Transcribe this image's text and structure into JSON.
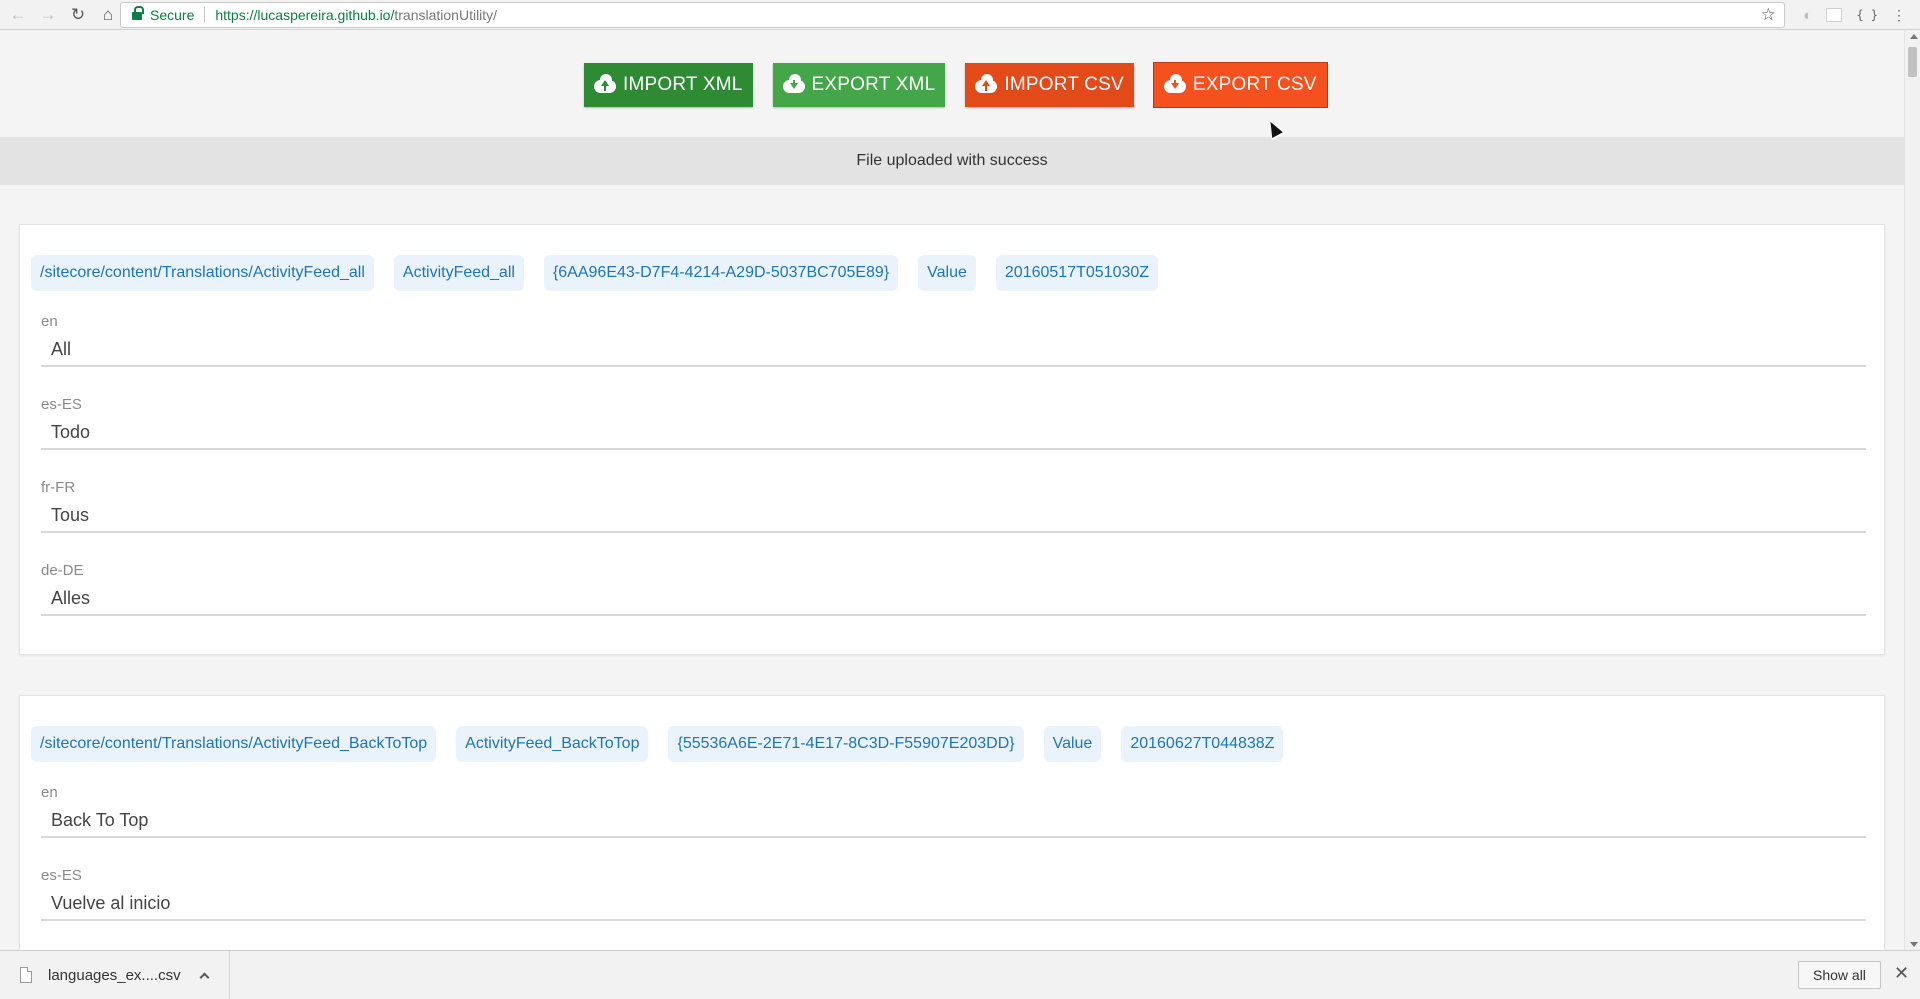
{
  "browser": {
    "secure_label": "Secure",
    "url_host": "https://lucaspereira.github.io/",
    "url_path": "translationUtility/"
  },
  "actions": [
    {
      "label": "IMPORT XML",
      "color": "#2e8b34",
      "direction": "up"
    },
    {
      "label": "EXPORT XML",
      "color": "#43a648",
      "direction": "down"
    },
    {
      "label": "IMPORT CSV",
      "color": "#e34a1a",
      "direction": "up"
    },
    {
      "label": "EXPORT CSV",
      "color": "#f4511e",
      "direction": "down"
    }
  ],
  "status_message": "File uploaded with success",
  "entries": [
    {
      "path": "/sitecore/content/Translations/ActivityFeed_all",
      "name": "ActivityFeed_all",
      "id": "{6AA96E43-D7F4-4214-A29D-5037BC705E89}",
      "field": "Value",
      "updated": "20160517T051030Z",
      "translations": [
        {
          "lang": "en",
          "text": "All"
        },
        {
          "lang": "es-ES",
          "text": "Todo"
        },
        {
          "lang": "fr-FR",
          "text": "Tous"
        },
        {
          "lang": "de-DE",
          "text": "Alles"
        }
      ]
    },
    {
      "path": "/sitecore/content/Translations/ActivityFeed_BackToTop",
      "name": "ActivityFeed_BackToTop",
      "id": "{55536A6E-2E71-4E17-8C3D-F55907E203DD}",
      "field": "Value",
      "updated": "20160627T044838Z",
      "translations": [
        {
          "lang": "en",
          "text": "Back To Top"
        },
        {
          "lang": "es-ES",
          "text": "Vuelve al inicio"
        }
      ]
    }
  ],
  "downloads": {
    "file_name": "languages_ex....csv",
    "show_all_label": "Show all",
    "close_glyph": "✕"
  }
}
